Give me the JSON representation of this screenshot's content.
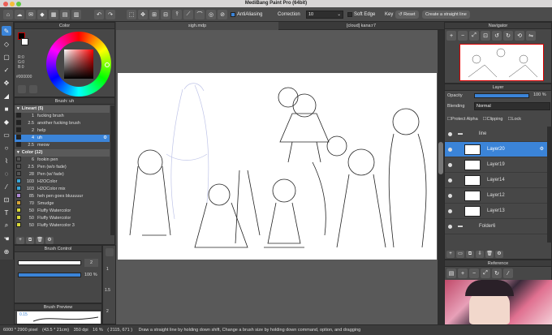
{
  "window": {
    "title": "MediBang Paint Pro (64bit)"
  },
  "toolbar": {
    "antialiasing_label": "AntiAliasing",
    "correction_label": "Correction",
    "correction_value": "10",
    "soft_edge_label": "Soft Edge",
    "key_label": "Key",
    "reset_label": "Reset",
    "straight_line_label": "Create a straight line"
  },
  "tabs": [
    {
      "label": "sigh.mdp"
    },
    {
      "label": "[cloud] kana:r7"
    }
  ],
  "color_panel": {
    "title": "Color",
    "r": "R:0",
    "g": "G:0",
    "b": "B:0",
    "hex": "#000000",
    "colors": {
      "primary": "#000000",
      "secondary": "#ffffff"
    }
  },
  "brush_panel": {
    "title": "Brush: uh",
    "groups": [
      {
        "name": "Lineart (5)",
        "items": [
          {
            "size": "1",
            "name": "fucking brush",
            "color": "#222222"
          },
          {
            "size": "2.5",
            "name": "another fucking brush",
            "color": "#222222"
          },
          {
            "size": "2",
            "name": "help",
            "color": "#222222"
          },
          {
            "size": "4",
            "name": "uh",
            "color": "#222222",
            "selected": true
          },
          {
            "size": "2.5",
            "name": "meow",
            "color": "#222222"
          }
        ]
      },
      {
        "name": "Color (12)",
        "items": [
          {
            "size": "6",
            "name": "fookin pen",
            "color": "#555555"
          },
          {
            "size": "2.5",
            "name": "Pen (w/o fade)",
            "color": "#555555"
          },
          {
            "size": "28",
            "name": "Pen (w/ fade)",
            "color": "#555555"
          },
          {
            "size": "103",
            "name": "H2OColor",
            "color": "#3aa6d8"
          },
          {
            "size": "103",
            "name": "H2OColor mix",
            "color": "#3aa6d8"
          },
          {
            "size": "85",
            "name": "heh pen goes bluuuuur",
            "color": "#b08ad8"
          },
          {
            "size": "70",
            "name": "Smudge",
            "color": "#d8a63a"
          },
          {
            "size": "50",
            "name": "Fluffy Watercolor",
            "color": "#d8d83a"
          },
          {
            "size": "50",
            "name": "Fluffy Watercolor",
            "color": "#d8d83a"
          },
          {
            "size": "50",
            "name": "Fluffy Watercolor 3",
            "color": "#d8d83a"
          }
        ]
      }
    ]
  },
  "brush_control": {
    "title": "Brush Control",
    "size": "2",
    "opacity": "100 %"
  },
  "brush_preview": {
    "title": "Brush Preview",
    "value": "0.15"
  },
  "size_list": [
    "1",
    "1.5",
    "2"
  ],
  "navigator": {
    "title": "Navigator"
  },
  "layer_panel": {
    "title": "Layer",
    "opacity_label": "Opacity",
    "opacity_value": "100 %",
    "blending_label": "Blending",
    "blending_value": "Normal",
    "protect_alpha": "Protect Alpha",
    "clipping": "Clipping",
    "lock": "Lock",
    "layers": [
      {
        "name": "line",
        "type": "folder"
      },
      {
        "name": "Layer20",
        "selected": true
      },
      {
        "name": "Layer19"
      },
      {
        "name": "Layer14"
      },
      {
        "name": "Layer12"
      },
      {
        "name": "Layer13"
      },
      {
        "name": "Folder6",
        "type": "folder"
      }
    ]
  },
  "reference": {
    "title": "Reference"
  },
  "status": {
    "canvas": "6000 * 2900 pixel",
    "physical": "(43.5 * 21cm)",
    "dpi": "350 dpi",
    "zoom": "16 %",
    "coords": "( 2115, 671 )",
    "hint": "Draw a straight line by holding down shift, Change a brush size by holding down command, option, and dragging"
  }
}
